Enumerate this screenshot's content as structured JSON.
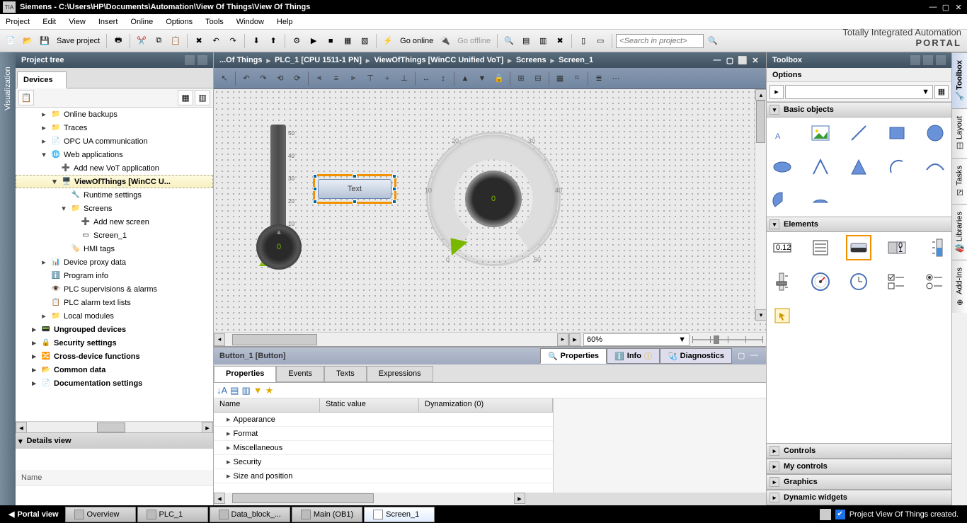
{
  "title": "Siemens  -  C:\\Users\\HP\\Documents\\Automation\\View Of Things\\View Of Things",
  "branding": {
    "line1": "Totally Integrated Automation",
    "line2": "PORTAL"
  },
  "menu": [
    "Project",
    "Edit",
    "View",
    "Insert",
    "Online",
    "Options",
    "Tools",
    "Window",
    "Help"
  ],
  "toolbar": {
    "save": "Save project",
    "go_online": "Go online",
    "go_offline": "Go offline",
    "search_ph": "<Search in project>"
  },
  "left": {
    "title": "Project tree",
    "tab": "Devices",
    "tree": [
      {
        "indent": 1,
        "exp": "▸",
        "icon": "📁",
        "label": "Online backups",
        "bold": false
      },
      {
        "indent": 1,
        "exp": "▸",
        "icon": "📁",
        "label": "Traces",
        "bold": false
      },
      {
        "indent": 1,
        "exp": "▸",
        "icon": "📄",
        "label": "OPC UA communication",
        "bold": false
      },
      {
        "indent": 1,
        "exp": "▾",
        "icon": "🌐",
        "label": "Web applications",
        "bold": false
      },
      {
        "indent": 2,
        "exp": "",
        "icon": "➕",
        "label": "Add new VoT application",
        "bold": false
      },
      {
        "indent": 2,
        "exp": "▾",
        "icon": "🖥️",
        "label": "ViewOfThings [WinCC U...",
        "bold": true,
        "sel": true
      },
      {
        "indent": 3,
        "exp": "",
        "icon": "🔧",
        "label": "Runtime settings",
        "bold": false
      },
      {
        "indent": 3,
        "exp": "▾",
        "icon": "📁",
        "label": "Screens",
        "bold": false
      },
      {
        "indent": 4,
        "exp": "",
        "icon": "➕",
        "label": "Add new screen",
        "bold": false
      },
      {
        "indent": 4,
        "exp": "",
        "icon": "▭",
        "label": "Screen_1",
        "bold": false
      },
      {
        "indent": 3,
        "exp": "",
        "icon": "🏷️",
        "label": "HMI tags",
        "bold": false
      },
      {
        "indent": 1,
        "exp": "▸",
        "icon": "📊",
        "label": "Device proxy data",
        "bold": false
      },
      {
        "indent": 1,
        "exp": "",
        "icon": "ℹ️",
        "label": "Program info",
        "bold": false
      },
      {
        "indent": 1,
        "exp": "",
        "icon": "👁️",
        "label": "PLC supervisions & alarms",
        "bold": false
      },
      {
        "indent": 1,
        "exp": "",
        "icon": "📋",
        "label": "PLC alarm text lists",
        "bold": false
      },
      {
        "indent": 1,
        "exp": "▸",
        "icon": "📁",
        "label": "Local modules",
        "bold": false
      },
      {
        "indent": 0,
        "exp": "▸",
        "icon": "📟",
        "label": "Ungrouped devices",
        "bold": true
      },
      {
        "indent": 0,
        "exp": "▸",
        "icon": "🔒",
        "label": "Security settings",
        "bold": true
      },
      {
        "indent": 0,
        "exp": "▸",
        "icon": "🔀",
        "label": "Cross-device functions",
        "bold": true
      },
      {
        "indent": 0,
        "exp": "▸",
        "icon": "📂",
        "label": "Common data",
        "bold": true
      },
      {
        "indent": 0,
        "exp": "▸",
        "icon": "📄",
        "label": "Documentation settings",
        "bold": true
      }
    ],
    "details_title": "Details view",
    "details_col": "Name"
  },
  "vbar_label": "Visualization",
  "breadcrumb": [
    "...Of Things",
    "PLC_1 [CPU 1511-1 PN]",
    "ViewOfThings [WinCC Unified VoT]",
    "Screens",
    "Screen_1"
  ],
  "canvas": {
    "button_text": "Text",
    "slider_value": "0",
    "slider_ticks": [
      "50",
      "40",
      "30",
      "20",
      "10"
    ],
    "gauge_value": "0",
    "gauge_ticks": [
      "0",
      "10",
      "20",
      "30",
      "40",
      "50"
    ],
    "zoom": "60%"
  },
  "bottom": {
    "object": "Button_1 [Button]",
    "tabs": [
      {
        "icon": "🔍",
        "label": "Properties",
        "active": true
      },
      {
        "icon": "ℹ️",
        "label": "Info",
        "badge": "ⓘ",
        "active": false
      },
      {
        "icon": "🩺",
        "label": "Diagnostics",
        "active": false
      }
    ],
    "subtabs": [
      "Properties",
      "Events",
      "Texts",
      "Expressions"
    ],
    "subtab_active": 0,
    "grid_headers": [
      "Name",
      "Static value",
      "Dynamization (0)"
    ],
    "grid_rows": [
      "Appearance",
      "Format",
      "Miscellaneous",
      "Security",
      "Size and position"
    ]
  },
  "right": {
    "title": "Toolbox",
    "options": "Options",
    "sections": {
      "basic": "Basic objects",
      "elements": "Elements",
      "controls": "Controls",
      "my_controls": "My controls",
      "graphics": "Graphics",
      "dynamic": "Dynamic widgets"
    },
    "tabs": [
      "Toolbox",
      "Layout",
      "Tasks",
      "Libraries",
      "Add-Ins"
    ]
  },
  "status": {
    "portal": "Portal view",
    "tabs": [
      {
        "icon": "≡",
        "label": "Overview",
        "sel": false
      },
      {
        "icon": "▭",
        "label": "PLC_1",
        "sel": false
      },
      {
        "icon": "▭",
        "label": "Data_block_...",
        "sel": false
      },
      {
        "icon": "▭",
        "label": "Main (OB1)",
        "sel": false
      },
      {
        "icon": "▭",
        "label": "Screen_1",
        "sel": true
      }
    ],
    "message": "Project View Of Things created."
  }
}
